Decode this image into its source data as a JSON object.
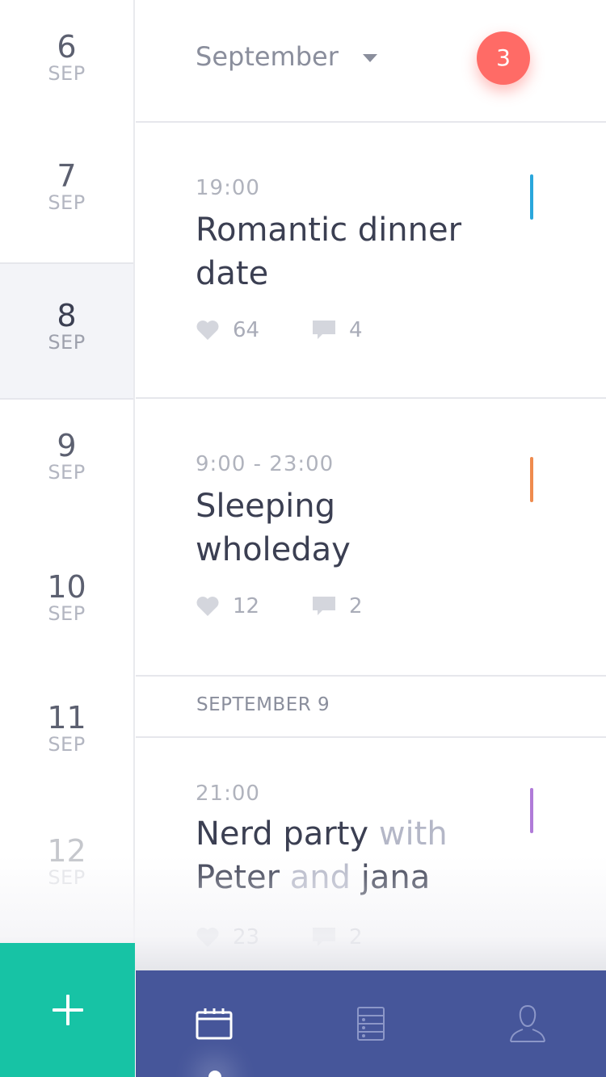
{
  "date_rail": {
    "items": [
      {
        "day": "6",
        "month": "SEP"
      },
      {
        "day": "7",
        "month": "SEP"
      },
      {
        "day": "8",
        "month": "SEP"
      },
      {
        "day": "9",
        "month": "SEP"
      },
      {
        "day": "10",
        "month": "SEP"
      },
      {
        "day": "11",
        "month": "SEP"
      },
      {
        "day": "12",
        "month": "SEP"
      }
    ],
    "selected_day": "8"
  },
  "header": {
    "month_label": "September",
    "notification_count": "3"
  },
  "events": [
    {
      "time": "19:00",
      "title_main": "Romantic dinner date",
      "title_muted": "",
      "likes": "64",
      "comments": "4",
      "accent_color": "#2aa7dc"
    },
    {
      "time": "9:00 - 23:00",
      "title_main": "Sleeping wholeday",
      "title_muted": "",
      "likes": "12",
      "comments": "2",
      "accent_color": "#ef8b4e"
    },
    {
      "time": "21:00",
      "title_main": "Nerd party",
      "title_muted": "with",
      "title_line2_main": "Peter",
      "title_line2_muted": "and",
      "title_line2_end": "jana",
      "likes": "23",
      "comments": "2",
      "accent_color": "#b07bd8"
    }
  ],
  "section_label": "SEPTEMBER 9",
  "bottom_bar": {
    "add_icon": "plus-icon",
    "tabs": [
      "calendar-icon",
      "list-icon",
      "profile-icon"
    ],
    "active_tab": "calendar-icon"
  },
  "colors": {
    "accent_teal": "#17c3a5",
    "tab_bar": "#46569a",
    "badge": "#ff6b66"
  }
}
